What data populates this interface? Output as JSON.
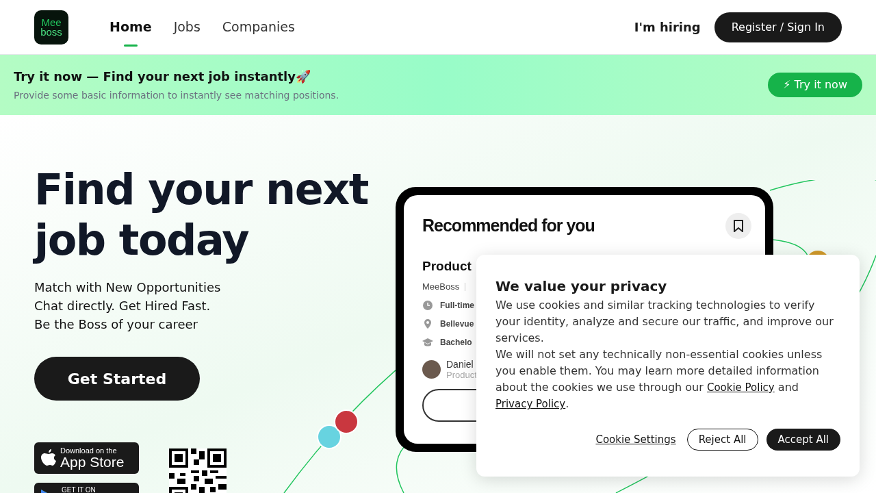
{
  "header": {
    "logo": {
      "line_1": "Mee",
      "line_2": "boss"
    },
    "nav": [
      {
        "label": "Home",
        "selected": true
      },
      {
        "label": "Jobs",
        "selected": false
      },
      {
        "label": "Companies",
        "selected": false
      }
    ],
    "hiring_link": "I'm hiring",
    "sign_in_button": "Register / Sign In"
  },
  "banner": {
    "title": "Try it now — Find your next job instantly🚀",
    "subtitle": "Provide some basic information to instantly see matching positions.",
    "button": "⚡ Try it now"
  },
  "hero": {
    "headline": "Find your next job today",
    "taglines": [
      "Match with New Opportunities",
      "Chat directly. Get Hired Fast.",
      "Be the Boss of your career"
    ],
    "cta": "Get Started",
    "app_store": {
      "small": "Download on the",
      "big": "App Store"
    },
    "google_play": {
      "small": "GET IT ON"
    }
  },
  "mockup": {
    "title": "Recommended for you",
    "job_title": "Product",
    "company": "MeeBoss",
    "details": [
      {
        "kind": "time",
        "text": "Full-time"
      },
      {
        "kind": "location",
        "text": "Bellevue"
      },
      {
        "kind": "education",
        "text": "Bachelo"
      }
    ],
    "recruiter_name": "Daniel",
    "recruiter_role": "Product"
  },
  "cookie_dialog": {
    "title": "We value your privacy",
    "paragraph_1": "We use cookies and similar tracking technologies to verify your identity, analyze and secure our traffic, and improve our services.",
    "paragraph_2_start": "We will not set any technically non-essential cookies unless you enable them. You may learn more detailed information about the cookies we use through our",
    "cookie_policy_link": "Cookie Policy",
    "joiner": "and",
    "privacy_policy_link": "Privacy Policy",
    "end": ".",
    "buttons": [
      {
        "kind": "link",
        "label": "Cookie Settings"
      },
      {
        "kind": "outline",
        "label": "Reject All"
      },
      {
        "kind": "solid",
        "label": "Accept All"
      }
    ]
  }
}
